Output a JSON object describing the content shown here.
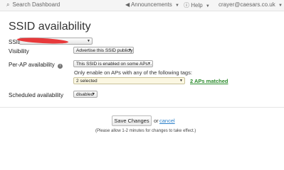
{
  "topbar": {
    "search_label": "Search Dashboard",
    "announcements_label": "Announcements",
    "help_label": "Help",
    "user_email": "crayer@caesars.co.uk"
  },
  "page": {
    "title": "SSID availability"
  },
  "form": {
    "ssid_label": "SSID:",
    "ssid_value": "",
    "visibility_label": "Visibility",
    "visibility_value": "Advertise this SSID publicly",
    "perap_label": "Per-AP availability",
    "perap_value": "This SSID is enabled on some APs...",
    "tags_hint": "Only enable on APs with any of the following tags:",
    "tags_value": "2 selected",
    "aps_matched_link": "2 APs matched",
    "scheduled_label": "Scheduled availability",
    "scheduled_value": "disabled"
  },
  "footer": {
    "save_label": "Save Changes",
    "or_text": "or",
    "cancel_label": "cancel",
    "note": "(Please allow 1-2 minutes for changes to take effect.)"
  },
  "icons": {
    "search": "search-icon",
    "bullhorn": "bullhorn-icon",
    "help": "help-icon",
    "info": "info-icon",
    "dropdown": "chevron-down-icon"
  },
  "colors": {
    "link_blue": "#2a7fc9",
    "matched_green": "#2a8a2a",
    "redaction_red": "#e8393b",
    "tags_field_bg": "#fbf7e2"
  }
}
